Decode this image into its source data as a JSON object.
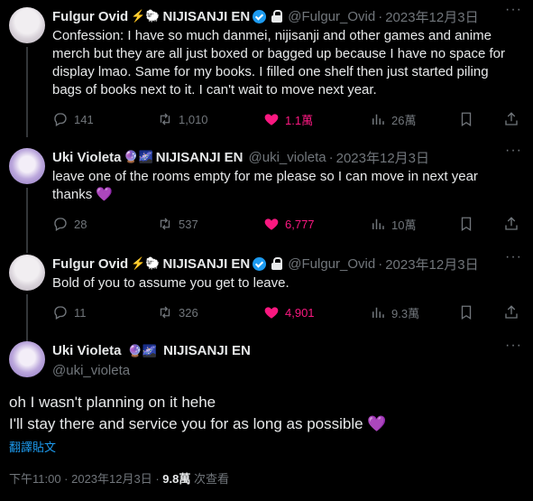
{
  "tweets": [
    {
      "name": "Fulgur Ovid",
      "name_emoji": "⚡🐑",
      "org": "NIJISANJI EN",
      "handle": "@Fulgur_Ovid",
      "date": "2023年12月3日",
      "text": "Confession: I have so much danmei, nijisanji and other games and anime merch but they are all just boxed or bagged up because I have no space for display lmao. Same for my books. I filled one shelf then just started piling bags of books next to it. I can't wait to move next year.",
      "replies": "141",
      "retweets": "1,010",
      "likes": "1.1萬",
      "views": "26萬"
    },
    {
      "name": "Uki Violeta",
      "name_emoji": "🔮🌌",
      "org": "NIJISANJI EN",
      "handle": "@uki_violeta",
      "date": "2023年12月3日",
      "text": "leave one of the rooms empty for me please so I can move in next year thanks 💜",
      "replies": "28",
      "retweets": "537",
      "likes": "6,777",
      "views": "10萬"
    },
    {
      "name": "Fulgur Ovid",
      "name_emoji": "⚡🐑",
      "org": "NIJISANJI EN",
      "handle": "@Fulgur_Ovid",
      "date": "2023年12月3日",
      "text": "Bold of you to assume you get to leave.",
      "replies": "11",
      "retweets": "326",
      "likes": "4,901",
      "views": "9.3萬"
    }
  ],
  "main": {
    "name": "Uki Violeta",
    "name_emoji": "🔮🌌",
    "org": "NIJISANJI EN",
    "handle": "@uki_violeta",
    "line1": "oh I wasn't planning on it hehe",
    "line2": "I'll stay there and service you for as long as possible 💜",
    "translate": "翻譯貼文",
    "time": "下午11:00 · 2023年12月3日 · ",
    "views": "9.8萬",
    "views_label": " 次查看"
  },
  "separator": "·",
  "colors": {
    "background": "#000000",
    "text": "#e7e9ea",
    "muted": "#71767b",
    "link": "#1d9bf0",
    "like": "#f91880",
    "verified": "#1d9bf0"
  }
}
